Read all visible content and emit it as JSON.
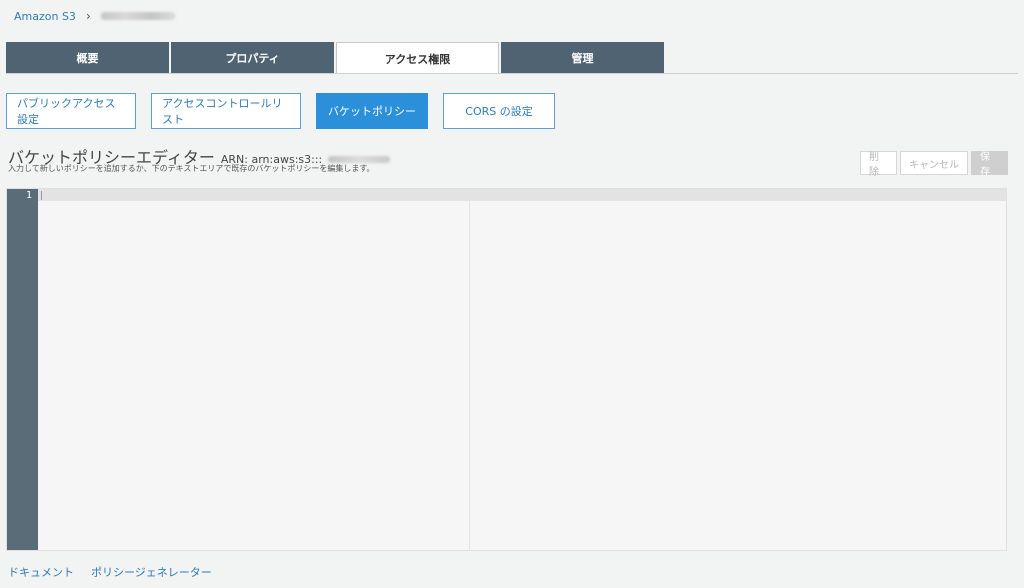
{
  "breadcrumb": {
    "root": "Amazon S3",
    "separator": "›"
  },
  "tabs": [
    {
      "label": "概要"
    },
    {
      "label": "プロパティ"
    },
    {
      "label": "アクセス権限"
    },
    {
      "label": "管理"
    }
  ],
  "subnav": [
    {
      "label": "パブリックアクセス設定"
    },
    {
      "label": "アクセスコントロールリスト"
    },
    {
      "label": "バケットポリシー"
    },
    {
      "label": "CORS の設定"
    }
  ],
  "editor": {
    "title": "バケットポリシーエディター",
    "arn_label": "ARN: arn:aws:s3:::",
    "help": "入力して新しいポリシーを追加するか、下のテキストエリアで既存のバケットポリシーを編集します。",
    "line_number": "1"
  },
  "actions": {
    "delete": "削除",
    "cancel": "キャンセル",
    "save": "保存"
  },
  "footer": {
    "docs": "ドキュメント",
    "generator": "ポリシージェネレーター"
  },
  "colors": {
    "tab_bg": "#4f6373",
    "accent": "#2b8fd9",
    "link": "#2e7bb7",
    "gutter": "#5b6c79"
  }
}
